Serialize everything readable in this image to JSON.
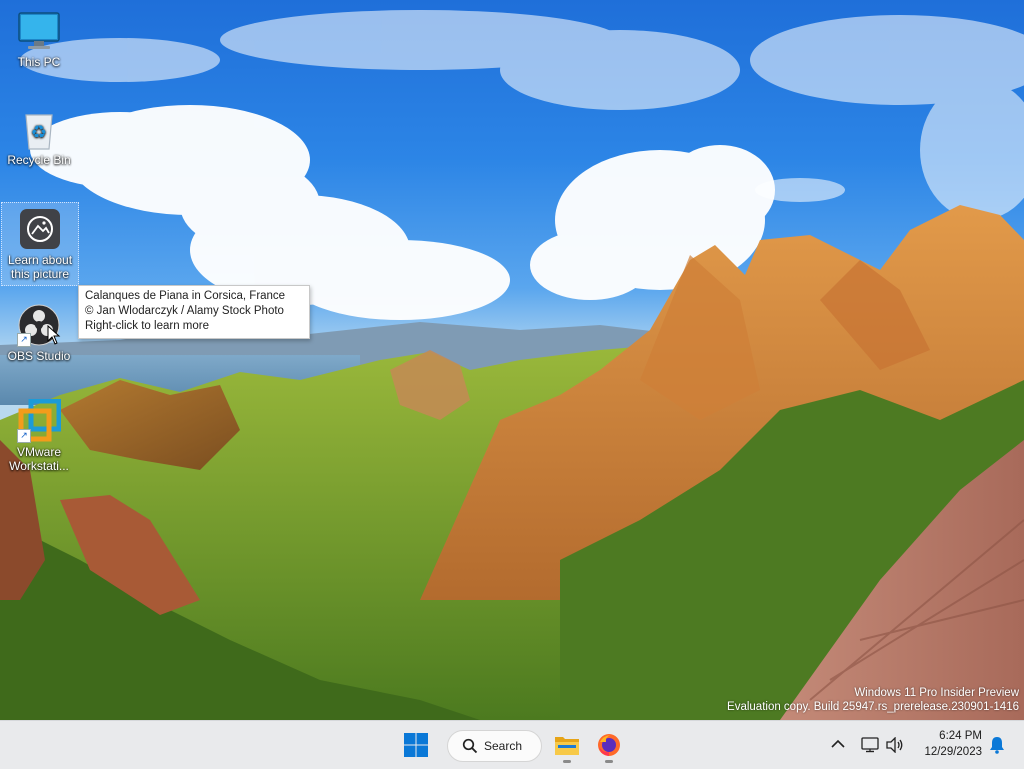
{
  "desktop_icons": [
    {
      "label": "This PC",
      "icon": "monitor-icon"
    },
    {
      "label": "Recycle Bin",
      "icon": "recycle-bin-icon"
    },
    {
      "label_line1": "Learn about",
      "label_line2": "this picture",
      "icon": "camera-info-icon",
      "selected": true
    },
    {
      "label": "OBS Studio",
      "icon": "obs-icon"
    },
    {
      "label_line1": "VMware",
      "label_line2": "Workstati...",
      "icon": "vmware-icon"
    }
  ],
  "tooltip": {
    "line1": "Calanques de Piana in Corsica, France",
    "line2": "© Jan Wlodarczyk / Alamy Stock Photo",
    "line3": "Right-click to learn more"
  },
  "watermark": {
    "line1": "Windows 11 Pro Insider Preview",
    "line2": "Evaluation copy. Build 25947.rs_prerelease.230901-1416"
  },
  "taskbar": {
    "search_label": "Search",
    "time": "6:24 PM",
    "date": "12/29/2023",
    "accent": "#0a78d7"
  }
}
